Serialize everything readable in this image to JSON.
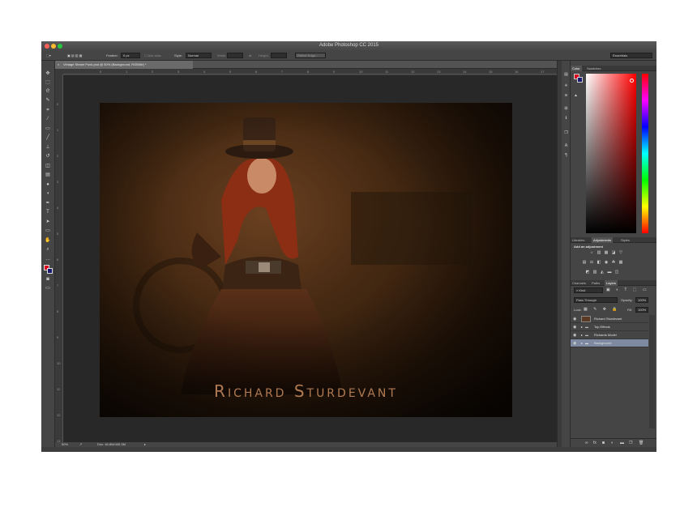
{
  "window": {
    "title": "Adobe Photoshop CC 2015",
    "workspace": "Essentials"
  },
  "options_bar": {
    "feather_label": "Feather:",
    "feather_value": "0 px",
    "anti_alias_label": "Anti-alias",
    "style_label": "Style:",
    "style_value": "Normal",
    "width_label": "Width:",
    "height_label": "Height:",
    "refine_edge_label": "Refine Edge..."
  },
  "document": {
    "tab_label": "Vintage Steam Punk.psd @ 50% (Background, RGB/8#) *",
    "zoom": "50%",
    "doc_size": "Doc: 46.8M/445.3M",
    "artwork_caption": "Richard Sturdevant"
  },
  "ruler": {
    "top_ticks": [
      "0",
      "1",
      "2",
      "3",
      "4",
      "5",
      "6",
      "7",
      "8",
      "9",
      "10",
      "11",
      "12",
      "13",
      "14",
      "15",
      "16",
      "17"
    ],
    "left_ticks": [
      "0",
      "1",
      "2",
      "3",
      "4",
      "5",
      "6",
      "7",
      "8",
      "9",
      "10",
      "11",
      "12",
      "13"
    ]
  },
  "color_panel": {
    "tabs": [
      "Color",
      "Swatches"
    ],
    "foreground_color": "#d9001f",
    "background_color": "#1a1a6e"
  },
  "adjustments_panel": {
    "tabs": [
      "Libraries",
      "Adjustments",
      "Styles"
    ],
    "heading": "Add an adjustment"
  },
  "layers_panel": {
    "tabs": [
      "Channels",
      "Paths",
      "Layers"
    ],
    "filter_kind": "Kind",
    "blend_mode": "Pass Through",
    "opacity_label": "Opacity:",
    "opacity_value": "100%",
    "lock_label": "Lock:",
    "fill_label": "Fill:",
    "fill_value": "100%",
    "layers": [
      {
        "name": "Richard Sturdevant",
        "type": "layer",
        "selected": false
      },
      {
        "name": "Top Effects",
        "type": "group",
        "selected": false
      },
      {
        "name": "Richards Model",
        "type": "group",
        "selected": false
      },
      {
        "name": "Background",
        "type": "group",
        "selected": true
      }
    ]
  },
  "icons": {
    "tools": [
      "move-tool-icon",
      "marquee-tool-icon",
      "lasso-tool-icon",
      "quick-select-tool-icon",
      "crop-tool-icon",
      "eyedropper-tool-icon",
      "healing-brush-icon",
      "brush-tool-icon",
      "clone-stamp-icon",
      "history-brush-icon",
      "eraser-tool-icon",
      "gradient-tool-icon",
      "blur-tool-icon",
      "dodge-tool-icon",
      "pen-tool-icon",
      "type-tool-icon",
      "path-select-icon",
      "shape-tool-icon",
      "hand-tool-icon",
      "zoom-tool-icon"
    ]
  }
}
